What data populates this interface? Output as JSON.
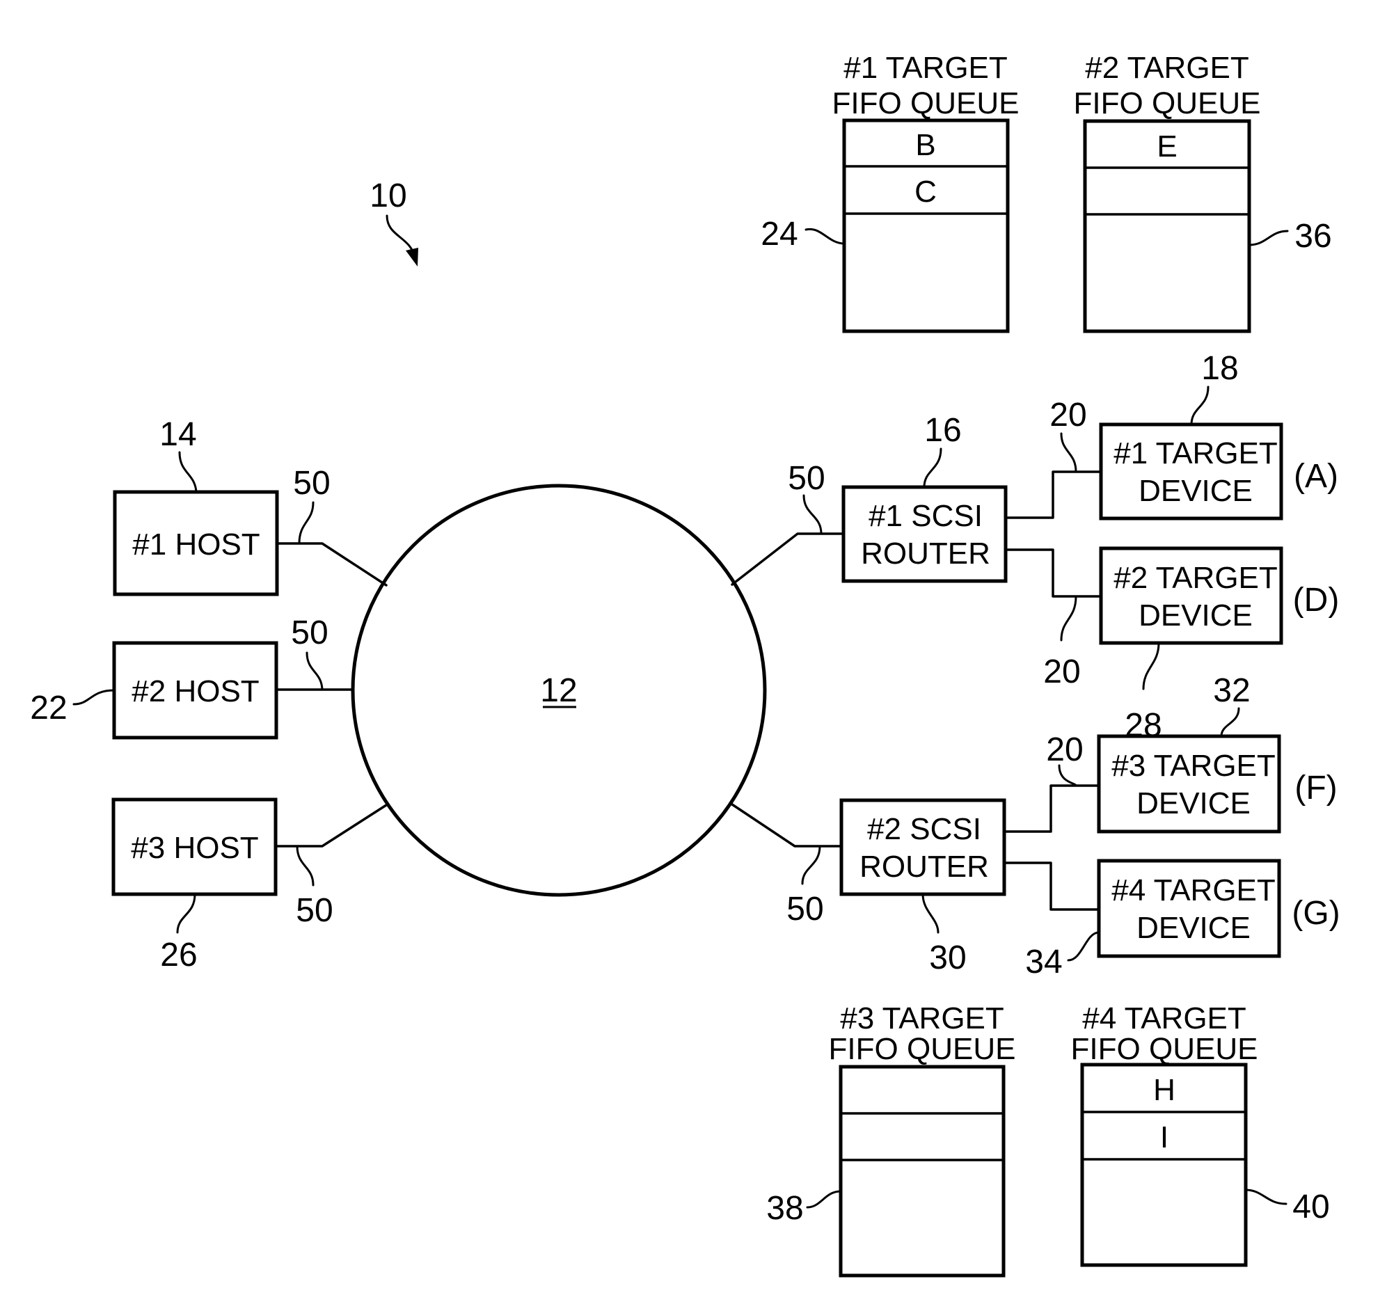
{
  "figure": {
    "figure_ref": "10",
    "network": {
      "ref": "12"
    },
    "hosts": [
      {
        "label": "#1  HOST",
        "ref": "14",
        "link_ref": "50"
      },
      {
        "label": "#2  HOST",
        "ref": "22",
        "link_ref": "50"
      },
      {
        "label": "#3  HOST",
        "ref": "26",
        "link_ref": "50"
      }
    ],
    "routers": [
      {
        "label_line1": "#1  SCSI",
        "label_line2": "ROUTER",
        "ref": "16",
        "link_ref": "50",
        "bus_refs": [
          "20",
          "20"
        ]
      },
      {
        "label_line1": "#2  SCSI",
        "label_line2": "ROUTER",
        "ref": "30",
        "link_ref": "50",
        "bus_refs": [
          "20"
        ]
      }
    ],
    "targets": [
      {
        "label_line1": "#1  TARGET",
        "label_line2": "DEVICE",
        "ref": "18",
        "tag": "(A)"
      },
      {
        "label_line1": "#2  TARGET",
        "label_line2": "DEVICE",
        "ref": "28",
        "tag": "(D)"
      },
      {
        "label_line1": "#3  TARGET",
        "label_line2": "DEVICE",
        "ref": "32",
        "tag": "(F)"
      },
      {
        "label_line1": "#4  TARGET",
        "label_line2": "DEVICE",
        "ref": "34",
        "tag": "(G)"
      }
    ],
    "queues": [
      {
        "title_line1": "#1  TARGET",
        "title_line2": "FIFO  QUEUE",
        "ref": "24",
        "entries": [
          "B",
          "C",
          ""
        ]
      },
      {
        "title_line1": "#2  TARGET",
        "title_line2": "FIFO  QUEUE",
        "ref": "36",
        "entries": [
          "E",
          "",
          ""
        ]
      },
      {
        "title_line1": "#3  TARGET",
        "title_line2": "FIFO  QUEUE",
        "ref": "38",
        "entries": [
          "",
          "",
          ""
        ]
      },
      {
        "title_line1": "#4  TARGET",
        "title_line2": "FIFO  QUEUE",
        "ref": "40",
        "entries": [
          "H",
          "I",
          ""
        ]
      }
    ]
  }
}
